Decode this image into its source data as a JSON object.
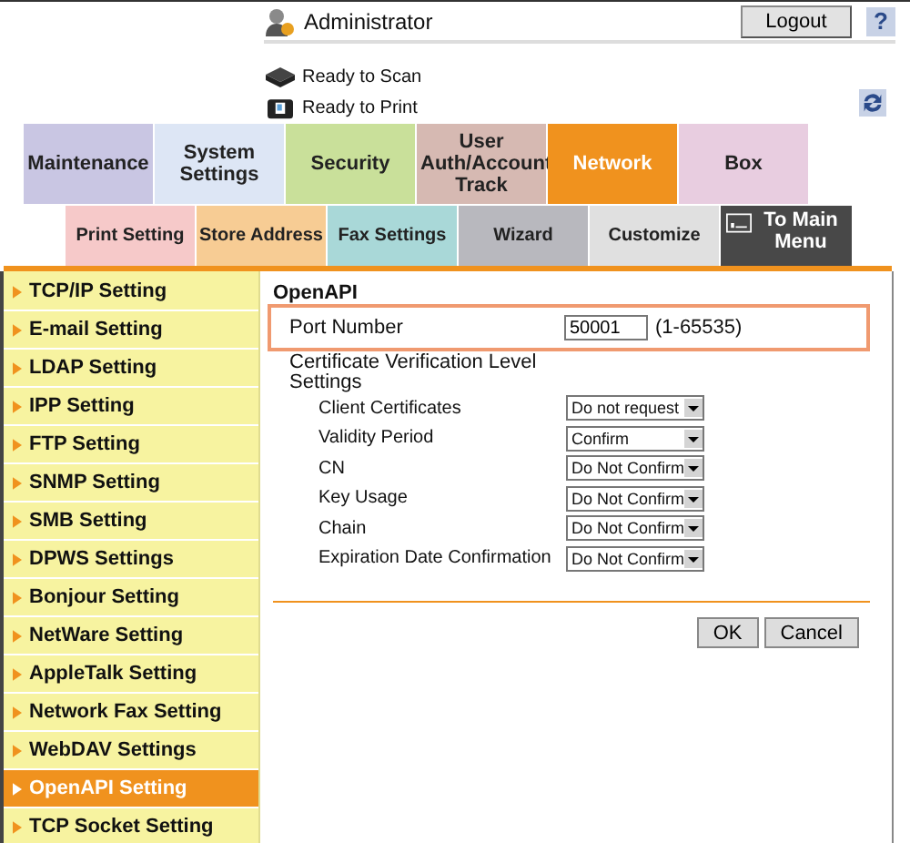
{
  "user": "Administrator",
  "logout_button": "Logout",
  "help_button": "?",
  "status": [
    {
      "kind": "scan",
      "text": "Ready to Scan"
    },
    {
      "kind": "print",
      "text": "Ready to Print"
    }
  ],
  "tabs": [
    {
      "label": "Maintenance",
      "color": "#c9c6e3",
      "selected": false
    },
    {
      "label": "System Settings",
      "color": "#dde6f5",
      "selected": false
    },
    {
      "label": "Security",
      "color": "#c9e09a",
      "selected": false
    },
    {
      "label": "User Auth/Account Track",
      "color": "#d6b9b2",
      "selected": false
    },
    {
      "label": "Network",
      "color": "#f0921e",
      "selected": true
    },
    {
      "label": "Box",
      "color": "#e8cde0",
      "selected": false
    }
  ],
  "subtabs": [
    {
      "label": "Print Setting",
      "color": "#f6c9c9"
    },
    {
      "label": "Store Address",
      "color": "#f7cc94"
    },
    {
      "label": "Fax Settings",
      "color": "#a9d8d8"
    },
    {
      "label": "Wizard",
      "color": "#b8b8be"
    },
    {
      "label": "Customize",
      "color": "#e0e0e0"
    }
  ],
  "main_menu_button": "To Main Menu",
  "sidebar": {
    "items": [
      {
        "label": "TCP/IP Setting",
        "selected": false
      },
      {
        "label": "E-mail Setting",
        "selected": false
      },
      {
        "label": "LDAP Setting",
        "selected": false
      },
      {
        "label": "IPP Setting",
        "selected": false
      },
      {
        "label": "FTP Setting",
        "selected": false
      },
      {
        "label": "SNMP Setting",
        "selected": false
      },
      {
        "label": "SMB Setting",
        "selected": false
      },
      {
        "label": "DPWS Settings",
        "selected": false
      },
      {
        "label": "Bonjour Setting",
        "selected": false
      },
      {
        "label": "NetWare Setting",
        "selected": false
      },
      {
        "label": "AppleTalk Setting",
        "selected": false
      },
      {
        "label": "Network Fax Setting",
        "selected": false
      },
      {
        "label": "WebDAV Settings",
        "selected": false
      },
      {
        "label": "OpenAPI Setting",
        "selected": true
      },
      {
        "label": "TCP Socket Setting",
        "selected": false
      }
    ]
  },
  "content": {
    "title": "OpenAPI",
    "port": {
      "label": "Port Number",
      "value": "50001",
      "range": "(1-65535)"
    },
    "certificate": {
      "label": "Certificate Verification Level Settings",
      "rows": [
        {
          "label": "Client Certificates",
          "value": "Do not request"
        },
        {
          "label": "Validity Period",
          "value": "Confirm"
        },
        {
          "label": "CN",
          "value": "Do Not Confirm"
        },
        {
          "label": "Key Usage",
          "value": "Do Not Confirm"
        },
        {
          "label": "Chain",
          "value": "Do Not Confirm"
        },
        {
          "label": "Expiration Date Confirmation",
          "value": "Do Not Confirm"
        }
      ]
    },
    "buttons": [
      "OK",
      "Cancel"
    ]
  }
}
